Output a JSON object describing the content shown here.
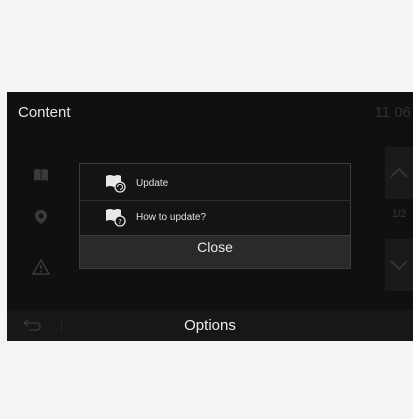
{
  "header": {
    "title": "Content",
    "clock": "11 06"
  },
  "left_icons": [
    "book-icon",
    "map-pin-icon",
    "warning-icon"
  ],
  "pager": {
    "indicator": "1/2",
    "up_icon": "chevron-up-icon",
    "down_icon": "chevron-down-icon"
  },
  "popup": {
    "items": [
      {
        "label": "Update",
        "icon": "update-icon"
      },
      {
        "label": "How to update?",
        "icon": "help-icon"
      }
    ],
    "close_label": "Close"
  },
  "bottom": {
    "back_icon": "back-arrow-icon",
    "options_label": "Options"
  },
  "colors": {
    "background": "#101010",
    "popup_bg": "#141414",
    "text": "#e6e6e6"
  }
}
